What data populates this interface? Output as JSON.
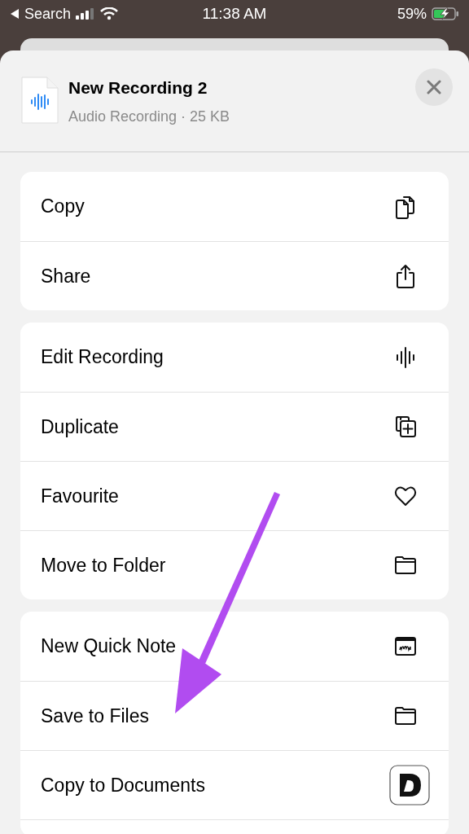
{
  "status_bar": {
    "back_label": "Search",
    "time": "11:38 AM",
    "battery": "59%"
  },
  "file": {
    "title": "New Recording 2",
    "subtitle": "Audio Recording · 25 KB"
  },
  "action_groups": [
    {
      "items": [
        {
          "label": "Copy"
        },
        {
          "label": "Share"
        }
      ]
    },
    {
      "items": [
        {
          "label": "Edit Recording"
        },
        {
          "label": "Duplicate"
        },
        {
          "label": "Favourite"
        },
        {
          "label": "Move to Folder"
        }
      ]
    },
    {
      "items": [
        {
          "label": "New Quick Note"
        },
        {
          "label": "Save to Files"
        },
        {
          "label": "Copy to Documents"
        }
      ]
    }
  ]
}
